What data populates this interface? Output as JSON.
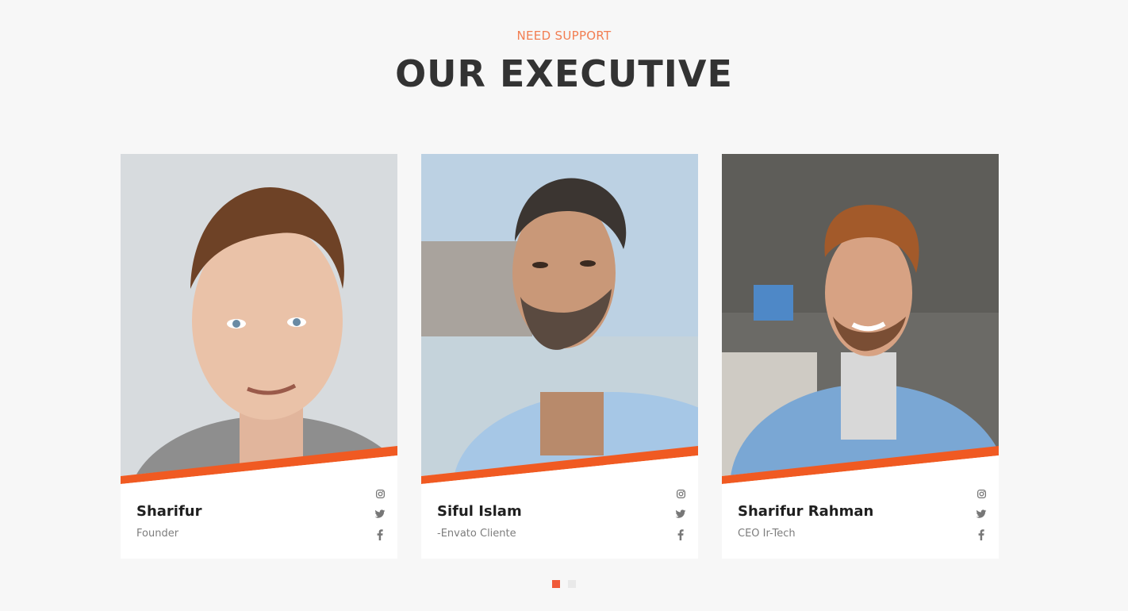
{
  "section": {
    "eyebrow": "NEED SUPPORT",
    "title": "OUR EXECUTIVE"
  },
  "members": [
    {
      "name": "Sharifur",
      "role": "Founder"
    },
    {
      "name": "Siful Islam",
      "role": "-Envato Cliente"
    },
    {
      "name": "Sharifur Rahman",
      "role": "CEO Ir-Tech"
    }
  ],
  "socials": [
    "instagram-icon",
    "twitter-icon",
    "facebook-icon"
  ],
  "carousel": {
    "pages": 2,
    "active": 1
  },
  "colors": {
    "accent": "#f05a22",
    "eyebrow": "#f27e52",
    "dot_active": "#f05a3a"
  }
}
